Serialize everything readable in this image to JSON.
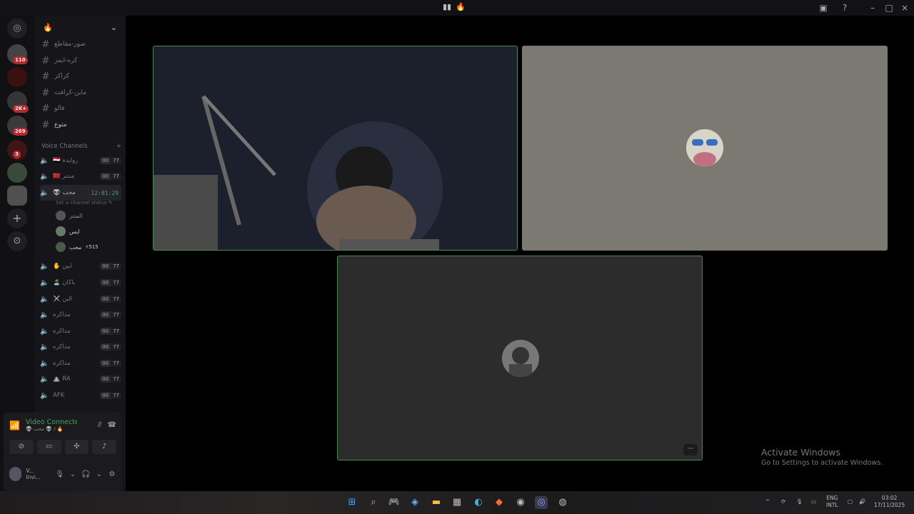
{
  "window": {
    "title_icons": [
      "people-icon",
      "fire-icon"
    ],
    "controls": [
      "minimize",
      "maximize",
      "close"
    ]
  },
  "servers": [
    {
      "badge": "110"
    },
    {
      "badge": ""
    },
    {
      "badge": "2K+"
    },
    {
      "badge": "269"
    },
    {
      "badge": "3"
    },
    {
      "badge": ""
    },
    {
      "badge": ""
    }
  ],
  "guild": {
    "name": "🔥"
  },
  "text_channels": [
    {
      "name": "صور-مقاطع"
    },
    {
      "name": "كره-ايمز"
    },
    {
      "name": "كراكز"
    },
    {
      "name": "ماين-كرافت"
    },
    {
      "name": "فالو"
    },
    {
      "name": "متوع"
    }
  ],
  "voice_category": "Voice Channels",
  "voice_channels": [
    {
      "name": "🇪🇬 روايدة",
      "count_a": "00",
      "count_b": "77"
    },
    {
      "name": "🇲🇦 منتنر",
      "count_a": "00",
      "count_b": "77"
    }
  ],
  "active_channel": {
    "name": "👽 محب",
    "timer": "12:01:29",
    "status": "Set a channel status",
    "members": [
      {
        "name": "المتنر",
        "tag": ""
      },
      {
        "name": "ايس",
        "tag": ""
      },
      {
        "name": "محب",
        "tag": "⚡515"
      }
    ]
  },
  "voice_channels_more": [
    {
      "name": "✋ ابين",
      "count_a": "00",
      "count_b": "77"
    },
    {
      "name": "🏝️ باكان",
      "count_a": "00",
      "count_b": "77"
    },
    {
      "name": "⚔️ الين",
      "count_a": "00",
      "count_b": "77"
    },
    {
      "name": "مذاكره",
      "count_a": "00",
      "count_b": "77"
    },
    {
      "name": "مذاكره",
      "count_a": "00",
      "count_b": "77"
    },
    {
      "name": "مذاكره",
      "count_a": "00",
      "count_b": "77"
    },
    {
      "name": "مذاكره",
      "count_a": "00",
      "count_b": "77"
    },
    {
      "name": "⛰️ RA",
      "count_a": "00",
      "count_b": "77"
    },
    {
      "name": "AFK",
      "count_a": "00",
      "count_b": "77"
    }
  ],
  "voice_panel": {
    "title": "Video Connected",
    "subtitle": "👽 محب 👽 / 🔥"
  },
  "user": {
    "name": "V...",
    "status": "Invi..."
  },
  "watermark": {
    "line1": "Activate Windows",
    "line2": "Go to Settings to activate Windows."
  },
  "tray": {
    "lang1": "ENG",
    "lang2": "INTL",
    "time": "03:02",
    "date": "17/11/2025"
  }
}
